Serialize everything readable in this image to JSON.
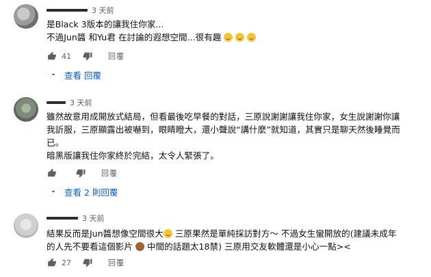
{
  "comments": [
    {
      "time": "3 天前",
      "lines": [
        "是Black 3版本的讓我住你家...",
        "不過Jun醬 和Yu君 在討論的遐想空間...很有趣"
      ],
      "likes": "41",
      "reply_label": "回覆",
      "view_replies": "查看 回覆"
    },
    {
      "time": "3 天前",
      "lines": [
        "雖然故意用成開放式結局，但看最後吃早餐的對話，三原說謝謝讓我住你家，女生說謝謝你讓",
        "我訢服，三原顯露出被嚇到，眼睛瞪大，還小聲說“講什麼”就知道，其實只是聊天然後睡覺而",
        "已。",
        "暗黑版讓我住你家終於完結，太令人緊張了。"
      ],
      "likes": "",
      "reply_label": "回覆",
      "view_replies": "查看 2 則回覆"
    },
    {
      "time": "3 天前",
      "lines": [
        "結果反而是Jun醬想像空間很大",
        " 三原果然是單純採訪對方～ 不過女生蠻開放的(建議未成年",
        "的人先不要看這個影片",
        " 中間的話題太18禁) 三原用交友軟體還是小心一點><"
      ],
      "likes": "27",
      "reply_label": "回覆"
    }
  ],
  "icons": {
    "like": "thumbs-up-icon",
    "dislike": "thumbs-down-icon",
    "expand": "chevron-down-icon"
  },
  "colors": {
    "link": "#065fd4",
    "meta": "#606060",
    "text": "#0f0f0f"
  }
}
